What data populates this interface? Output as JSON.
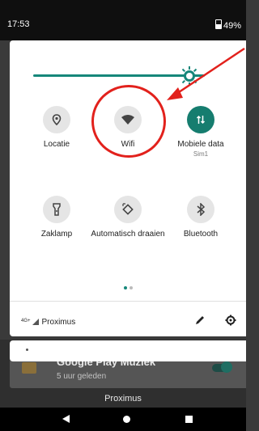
{
  "status_bar": {
    "time": "17:53",
    "battery": "49%"
  },
  "brightness": {
    "level": 0.88
  },
  "tiles": [
    {
      "label": "Locatie",
      "sublabel": "",
      "icon": "location-pin-icon",
      "active": false
    },
    {
      "label": "Wifi",
      "sublabel": "",
      "icon": "wifi-icon",
      "active": false
    },
    {
      "label": "Mobiele data",
      "sublabel": "Sim1",
      "icon": "mobile-data-icon",
      "active": true
    },
    {
      "label": "Zaklamp",
      "sublabel": "",
      "icon": "flashlight-icon",
      "active": false
    },
    {
      "label": "Automatisch draaien",
      "sublabel": "",
      "icon": "auto-rotate-icon",
      "active": false
    },
    {
      "label": "Bluetooth",
      "sublabel": "",
      "icon": "bluetooth-icon",
      "active": false
    }
  ],
  "page_indicator": {
    "current": 1,
    "total": 2
  },
  "footer": {
    "network_type": "4G+",
    "operator": "Proximus"
  },
  "background": {
    "notification_title": "Google Play Muziek",
    "notification_time": "5 uur geleden",
    "operator_label": "Proximus"
  },
  "colors": {
    "accent": "#167d6f",
    "annotation": "#e2211c"
  }
}
